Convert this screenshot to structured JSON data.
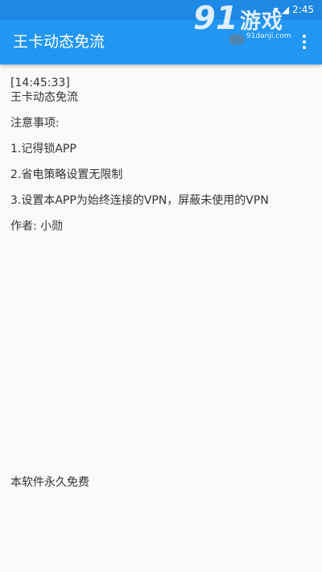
{
  "status_bar": {
    "time": "2:45",
    "bg_color": "#1e88e5"
  },
  "app_bar": {
    "title": "王卡动态免流",
    "bg_color": "#2196f3",
    "menu_icon": "more-vert-icon"
  },
  "watermark": {
    "logo_number": "91",
    "logo_text": "游戏",
    "url": "91danji.com"
  },
  "log": {
    "timestamp": "[14:45:33]",
    "app_name": "王卡动态免流",
    "notice_header": "注意事项:",
    "items": [
      "1.记得锁APP",
      "2.省电策略设置无限制",
      "3.设置本APP为始终连接的VPN，屏蔽未使用的VPN"
    ],
    "author": "作者: 小勋"
  },
  "footer": {
    "text": "本软件永久免费"
  }
}
